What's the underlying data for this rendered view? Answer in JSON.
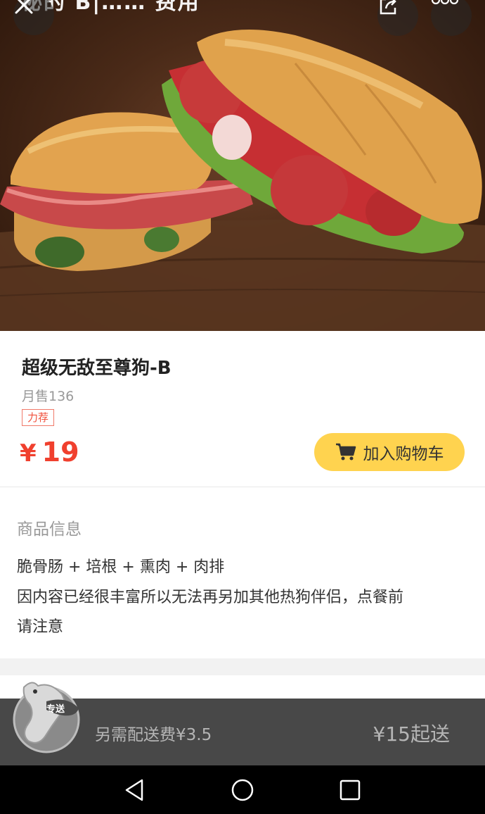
{
  "header": {
    "title_fragment": "秘的 B|…… 费用",
    "buttons": {
      "close": "close-icon",
      "share": "share-icon",
      "more": "more-icon"
    }
  },
  "product": {
    "name": "超级无敌至尊狗-B",
    "monthly_sales": "月售136",
    "tag": "力荐",
    "currency": "¥",
    "price": "19",
    "add_to_cart": "加入购物车"
  },
  "details": {
    "section_title": "商品信息",
    "line1": "脆骨肠 + 培根 + 熏肉 + 肉排",
    "line2": "因内容已经很丰富所以无法再另加其他热狗伴侣，点餐前",
    "line3": "请注意"
  },
  "cart_bar": {
    "mascot_badge": "专送",
    "delivery_fee": "另需配送费¥3.5",
    "min_order": "¥15起送"
  },
  "colors": {
    "price": "#f0402e",
    "add_cart_button": "#ffd34f",
    "cart_bar": "#484848",
    "tag_border": "#f07a6a"
  }
}
